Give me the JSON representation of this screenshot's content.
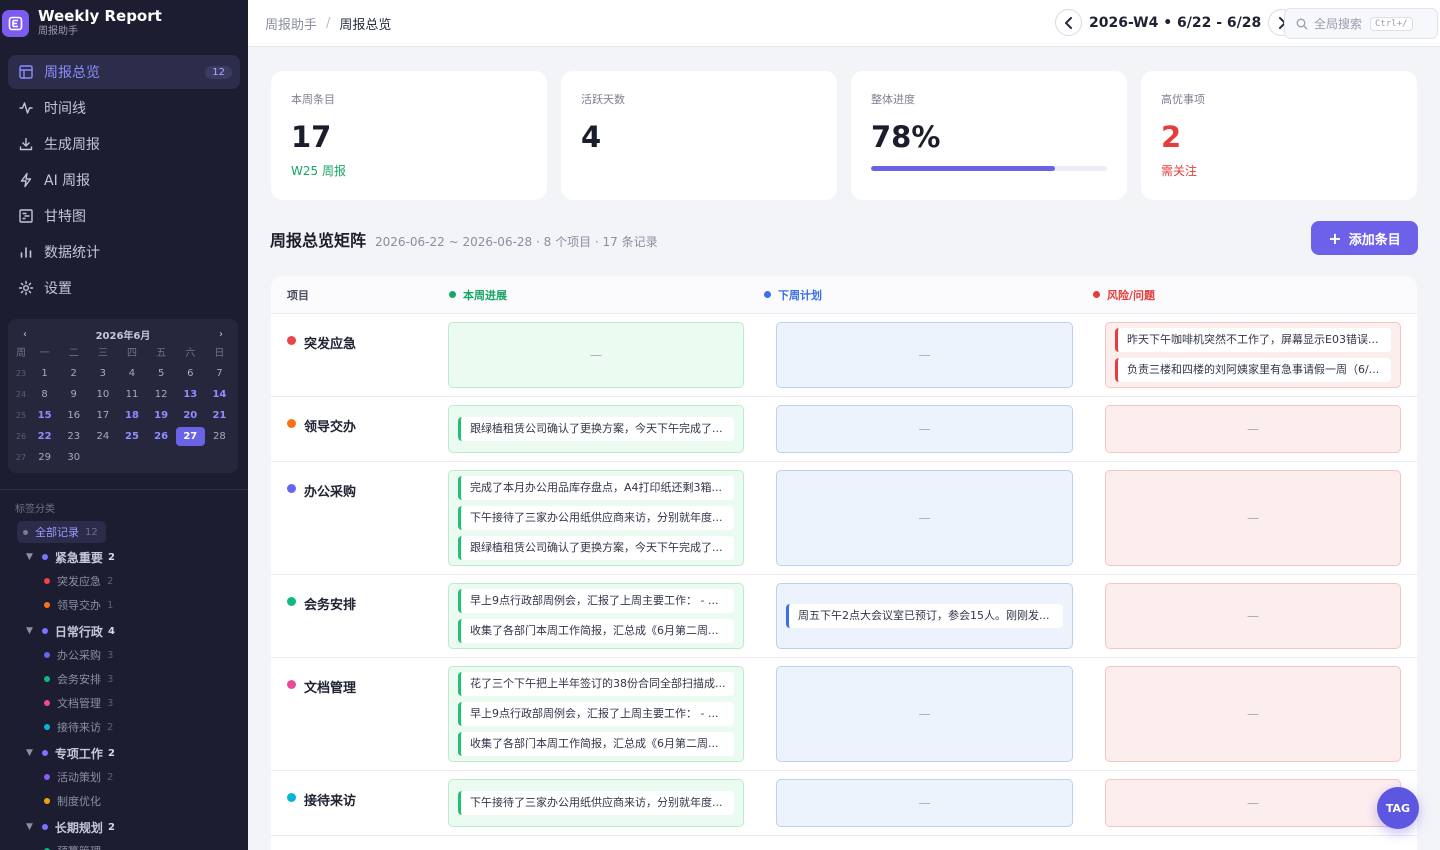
{
  "brand": {
    "title": "Weekly Report",
    "subtitle": "周报助手"
  },
  "nav": [
    {
      "label": "周报总览",
      "badge": "12",
      "icon": "layout-icon",
      "active": true
    },
    {
      "label": "时间线",
      "icon": "activity-icon"
    },
    {
      "label": "生成周报",
      "icon": "download-icon"
    },
    {
      "label": "AI 周报",
      "icon": "lightning-icon"
    },
    {
      "label": "甘特图",
      "icon": "gantt-icon"
    },
    {
      "label": "数据统计",
      "icon": "bar-chart-icon"
    },
    {
      "label": "设置",
      "icon": "gear-icon"
    }
  ],
  "calendar": {
    "month": "2026年6月",
    "prev": "‹",
    "next": "›",
    "weekdays": [
      "周",
      "一",
      "二",
      "三",
      "四",
      "五",
      "六",
      "日"
    ],
    "weeks": [
      {
        "wk": "23",
        "days": [
          {
            "d": "1"
          },
          {
            "d": "2"
          },
          {
            "d": "3"
          },
          {
            "d": "4"
          },
          {
            "d": "5"
          },
          {
            "d": "6"
          },
          {
            "d": "7"
          }
        ]
      },
      {
        "wk": "24",
        "days": [
          {
            "d": "8"
          },
          {
            "d": "9"
          },
          {
            "d": "10"
          },
          {
            "d": "11"
          },
          {
            "d": "12"
          },
          {
            "d": "13",
            "h": true
          },
          {
            "d": "14",
            "h": true
          }
        ]
      },
      {
        "wk": "25",
        "days": [
          {
            "d": "15",
            "h": true
          },
          {
            "d": "16"
          },
          {
            "d": "17"
          },
          {
            "d": "18",
            "h": true
          },
          {
            "d": "19",
            "h": true
          },
          {
            "d": "20",
            "h": true
          },
          {
            "d": "21",
            "h": true
          }
        ]
      },
      {
        "wk": "26",
        "days": [
          {
            "d": "22",
            "h": true
          },
          {
            "d": "23"
          },
          {
            "d": "24"
          },
          {
            "d": "25",
            "h": true
          },
          {
            "d": "26",
            "h": true
          },
          {
            "d": "27",
            "t": true
          },
          {
            "d": "28"
          }
        ]
      },
      {
        "wk": "27",
        "days": [
          {
            "d": "29"
          },
          {
            "d": "30"
          }
        ]
      }
    ]
  },
  "tags": {
    "title": "标签分类",
    "all": {
      "label": "全部记录",
      "count": "12"
    },
    "groups": [
      {
        "label": "紧急重要",
        "count": "2",
        "children": [
          {
            "label": "突发应急",
            "count": "2",
            "color": "#ef4444"
          },
          {
            "label": "领导交办",
            "count": "1",
            "color": "#f97316"
          }
        ]
      },
      {
        "label": "日常行政",
        "count": "4",
        "children": [
          {
            "label": "办公采购",
            "count": "3",
            "color": "#6366f1"
          },
          {
            "label": "会务安排",
            "count": "3",
            "color": "#10b981"
          },
          {
            "label": "文档管理",
            "count": "3",
            "color": "#ec4899"
          },
          {
            "label": "接待来访",
            "count": "2",
            "color": "#06b6d4"
          }
        ]
      },
      {
        "label": "专项工作",
        "count": "2",
        "children": [
          {
            "label": "活动策划",
            "count": "2",
            "color": "#8b5cf6"
          },
          {
            "label": "制度优化",
            "count": "",
            "color": "#f59e0b"
          }
        ]
      },
      {
        "label": "长期规划",
        "count": "2",
        "children": [
          {
            "label": "预算管理",
            "count": "",
            "color": "#10b981"
          }
        ]
      }
    ]
  },
  "header": {
    "breadcrumb": [
      "周报助手",
      "周报总览"
    ],
    "breadcrumb_sep": "/",
    "week_label": "2026-W4 • 6/22 - 6/28",
    "search_placeholder": "全局搜索",
    "search_kbd": "Ctrl+/"
  },
  "stats": [
    {
      "label": "本周条目",
      "value": "17",
      "sub": "W25 周报",
      "sub_color": "green"
    },
    {
      "label": "活跃天数",
      "value": "4",
      "sub": ""
    },
    {
      "label": "整体进度",
      "value": "78%",
      "sub": "",
      "progress": 0.78
    },
    {
      "label": "高优事项",
      "value": "2",
      "sub": "需关注",
      "sub_color": "red",
      "value_color": "red"
    }
  ],
  "section": {
    "title": "周报总览矩阵",
    "meta": "2026-06-22 ~ 2026-06-28 · 8 个项目 · 17 条记录",
    "add_label": "添加条目",
    "add_icon": "+"
  },
  "matrix": {
    "headers": {
      "project": "项目",
      "progress": "本周进展",
      "plan": "下周计划",
      "risk": "风险/问题"
    },
    "empty": "—",
    "rows": [
      {
        "project": "突发应急",
        "color": "#ef4444",
        "progress": [],
        "plan": [],
        "risk": [
          "昨天下午咖啡机突然不工作了，屏幕显示E03错误...",
          "负责三楼和四楼的刘阿姨家里有急事请假一周（6/..."
        ]
      },
      {
        "project": "领导交办",
        "color": "#f97316",
        "progress": [
          "跟绿植租赁公司确认了更换方案，今天下午完成了..."
        ],
        "plan": [],
        "risk": []
      },
      {
        "project": "办公采购",
        "color": "#6366f1",
        "progress": [
          "完成了本月办公用品库存盘点，A4打印纸还剩3箱...",
          "下午接待了三家办公用纸供应商来访，分别就年度...",
          "跟绿植租赁公司确认了更换方案，今天下午完成了..."
        ],
        "plan": [],
        "risk": []
      },
      {
        "project": "会务安排",
        "color": "#10b981",
        "progress": [
          "早上9点行政部周例会，汇报了上周主要工作： - ...",
          "收集了各部门本周工作简报，汇总成《6月第二周..."
        ],
        "plan": [
          "周五下午2点大会议室已预订，参会15人。刚刚发..."
        ],
        "risk": []
      },
      {
        "project": "文档管理",
        "color": "#ec4899",
        "progress": [
          "花了三个下午把上半年签订的38份合同全部扫描成...",
          "早上9点行政部周例会，汇报了上周主要工作： - ...",
          "收集了各部门本周工作简报，汇总成《6月第二周..."
        ],
        "plan": [],
        "risk": []
      },
      {
        "project": "接待来访",
        "color": "#06b6d4",
        "progress": [
          "下午接待了三家办公用纸供应商来访，分别就年度..."
        ],
        "plan": [],
        "risk": []
      }
    ]
  },
  "fab": {
    "label": "TAG"
  }
}
